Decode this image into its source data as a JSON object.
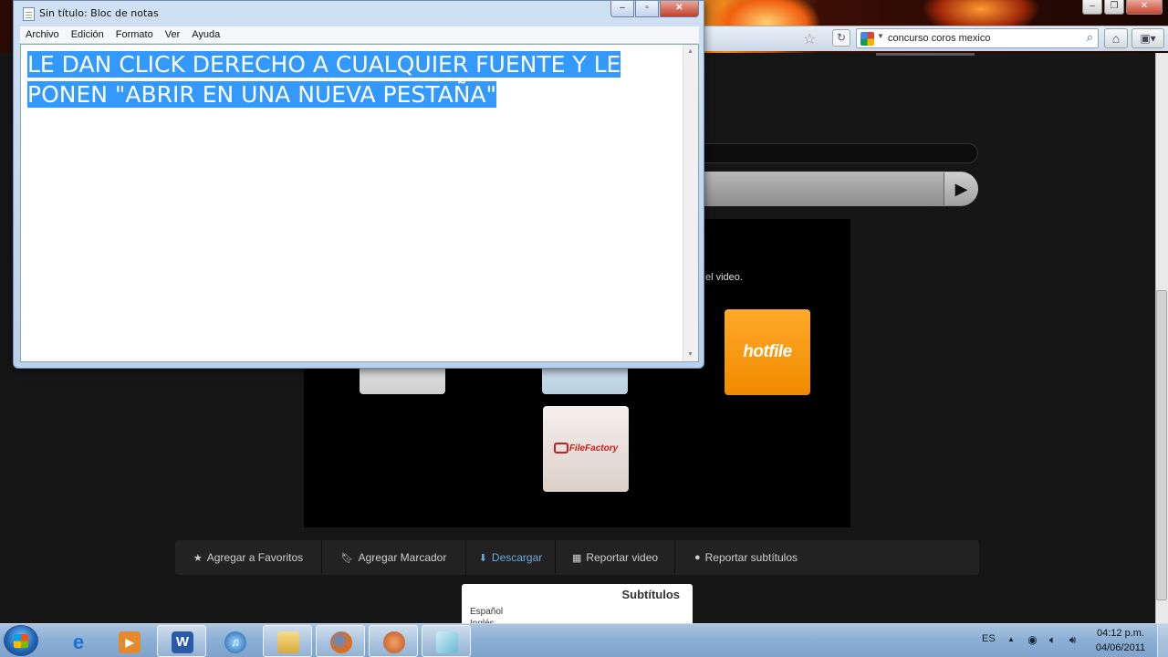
{
  "browser": {
    "search_text": "concurso coros mexico"
  },
  "page": {
    "panel_text": "el video.",
    "hosts": [
      {
        "name": "hotfile"
      },
      {
        "name": "FileFactory"
      }
    ],
    "actions": [
      {
        "icon": "star-icon",
        "label": "Agregar a Favoritos"
      },
      {
        "icon": "bookmark-icon",
        "label": "Agregar Marcador"
      },
      {
        "icon": "download-icon",
        "label": "Descargar"
      },
      {
        "icon": "film-icon",
        "label": "Reportar video"
      },
      {
        "icon": "comment-icon",
        "label": "Reportar subtítulos"
      }
    ],
    "subtitles": {
      "title": "Subtítulos",
      "languages": [
        "Español",
        "Inglés"
      ]
    }
  },
  "notepad": {
    "title": "Sin título: Bloc de notas",
    "menu": [
      "Archivo",
      "Edición",
      "Formato",
      "Ver",
      "Ayuda"
    ],
    "text_line1": "LE DAN CLICK DERECHO A CUALQUIER FUENTE Y LE",
    "text_line2": "PONEN \"ABRIR EN UNA NUEVA PESTAÑA\""
  },
  "taskbar": {
    "language": "ES",
    "time": "04:12 p.m.",
    "date": "04/06/2011"
  },
  "colors": {
    "selection": "#3399ff",
    "hotfile": "#f39200",
    "action_active": "#6ea8dc"
  }
}
